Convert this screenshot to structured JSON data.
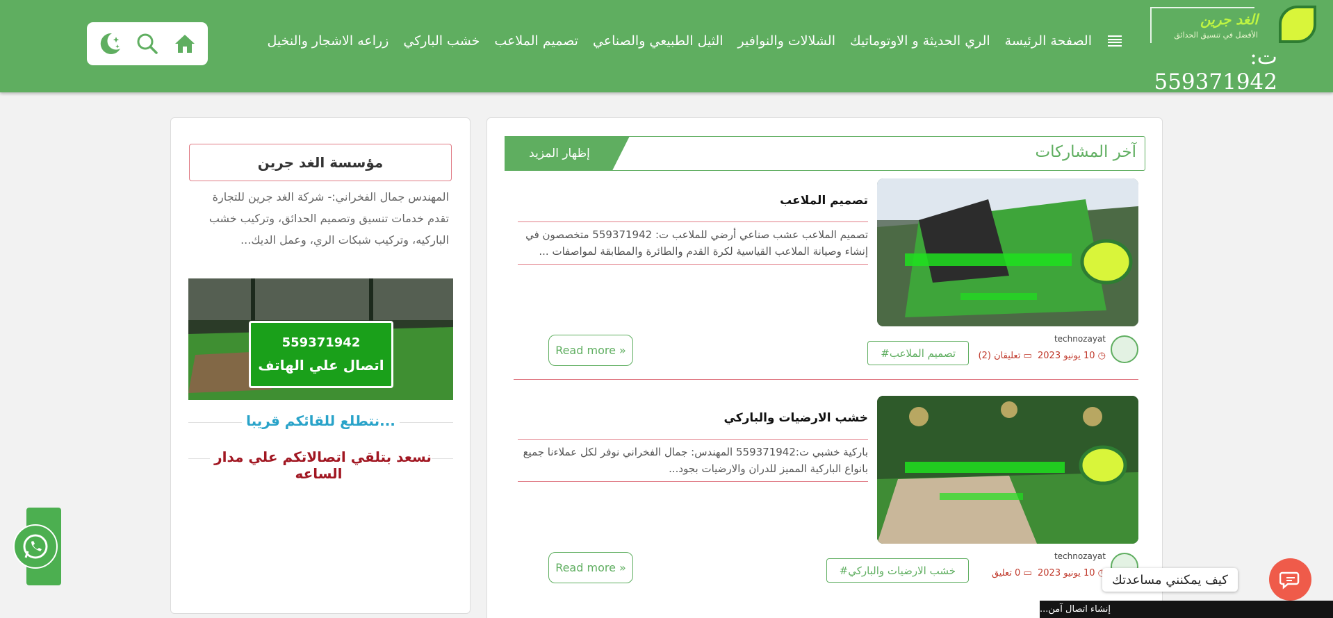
{
  "header": {
    "logo": {
      "name": "الغد جرين",
      "tagline": "الأفضل في تنسيق الحدائق",
      "phone": "ت: 559371942"
    },
    "nav": [
      {
        "label": "الصفحة الرئيسة"
      },
      {
        "label": "الري الحديثة و الاوتوماتيك"
      },
      {
        "label": "الشلالات والنوافير"
      },
      {
        "label": "الثيل الطبيعي والصناعي"
      },
      {
        "label": "تصميم الملاعب"
      },
      {
        "label": "خشب الباركي"
      },
      {
        "label": "زراعه الاشجار والنخيل"
      }
    ]
  },
  "main": {
    "section_title": "آخر المشاركات",
    "show_more": "إظهار المزيد",
    "posts": [
      {
        "title": "تصميم الملاعب",
        "excerpt": "تصميم الملاعب    عشب صناعي أرضي للملاعب     ت:    559371942 متخصصون في إنشاء وصيانة الملاعب القياسية لكرة القدم والطائرة والمطابقة لمواصفات ...",
        "author": "technozayat",
        "date": "10 يونيو 2023",
        "comments": "تعليقان (2)",
        "tag": "#تصميم الملاعب",
        "read_more": "Read more »"
      },
      {
        "title": "خشب الارضيات والباركي",
        "excerpt": "باركية خشبي     ت:559371942  المهندس: جمال الفخراني نوفر لكل عملاءنا جميع بانواع الباركية المميز للدران والارضيات بجود...",
        "author": "technozayat",
        "date": "10 يونيو 2023",
        "comments": "0 تعليق",
        "tag": "#خشب الارضيات والباركي",
        "read_more": "Read more »"
      }
    ]
  },
  "sidebar": {
    "title": "مؤسسة الغد جرين",
    "text": "المهندس جمال الفخراني:-  شركة الغد جرين للتجارة تقدم خدمات تنسيق وتصميم الحدائق، وتركيب خشب الباركيه، وتركيب شبكات الري، وعمل الديك...",
    "ad": {
      "phone": "559371942",
      "label": "اتصال علي الهاتف"
    },
    "caption1": "نتطلع للقائكم قريبا...",
    "caption2": "نسعد بتلقي اتصالاتكم علي مدار الساعه"
  },
  "chat": {
    "bubble": "كيف يمكنني مساعدتك"
  },
  "status_bar": "إنشاء اتصال آمن...",
  "colors": {
    "brand_green": "#5fae60",
    "accent_red": "#e07a84",
    "chat_red": "#ef5b4a",
    "caption_blue": "#29a3c9",
    "caption_maroon": "#a11722"
  }
}
